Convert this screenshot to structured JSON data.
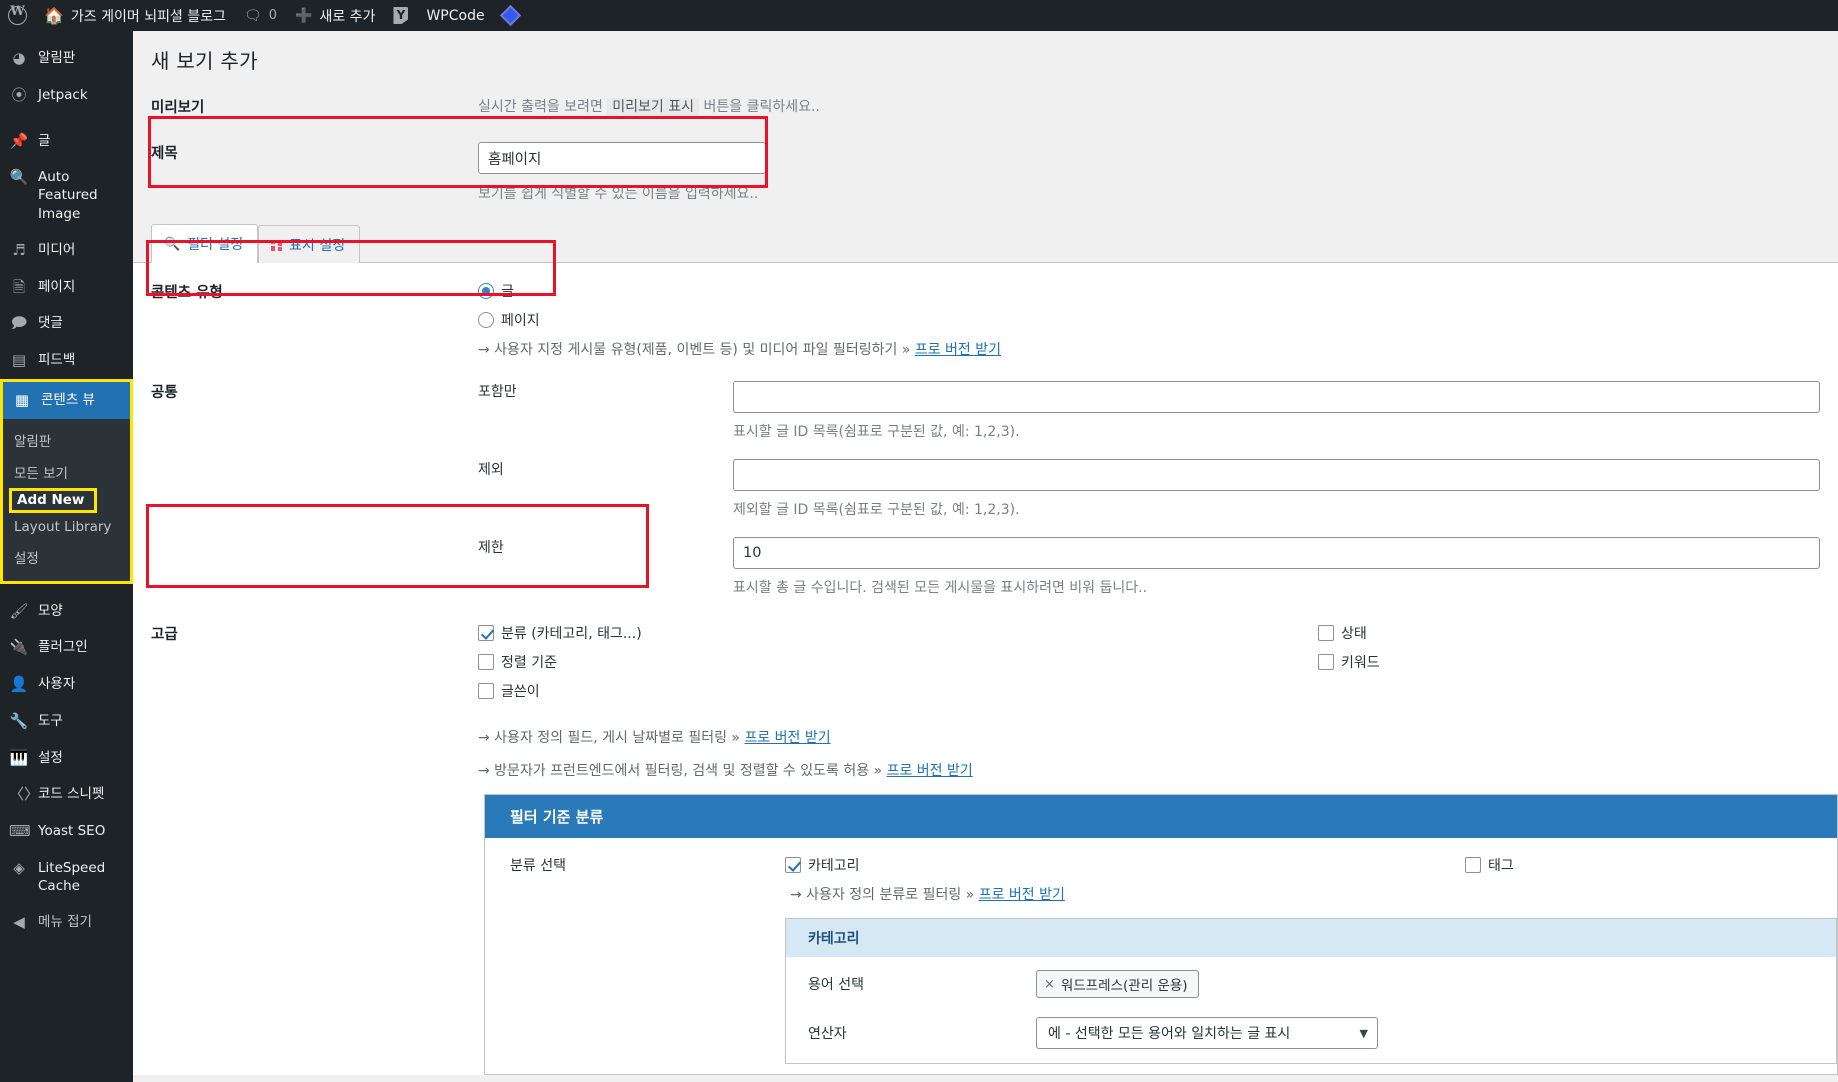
{
  "adminbar": {
    "wp_logo": "wordpress-logo",
    "site_name": "가즈 게이머 뇌피셜 블로그",
    "comments_count": "0",
    "new_label": "새로 추가",
    "wpcode_label": "WPCode"
  },
  "sidebar": {
    "items": [
      {
        "label": "알림판",
        "icon": "dashboard-icon"
      },
      {
        "label": "Jetpack",
        "icon": "jetpack-icon"
      },
      {
        "label": "글",
        "icon": "pin-icon"
      },
      {
        "label": "Auto Featured Image",
        "icon": "image-search-icon"
      },
      {
        "label": "미디어",
        "icon": "media-icon"
      },
      {
        "label": "페이지",
        "icon": "page-icon"
      },
      {
        "label": "댓글",
        "icon": "comment-icon"
      },
      {
        "label": "피드백",
        "icon": "feedback-icon"
      }
    ],
    "current": {
      "label": "콘텐츠 뷰",
      "icon": "content-views-icon"
    },
    "submenu": [
      {
        "label": "알림판",
        "active": false
      },
      {
        "label": "모든 보기",
        "active": false
      },
      {
        "label": "Add New",
        "active": true
      },
      {
        "label": "Layout Library",
        "active": false
      },
      {
        "label": "설정",
        "active": false
      }
    ],
    "items_after": [
      {
        "label": "모양",
        "icon": "appearance-icon"
      },
      {
        "label": "플러그인",
        "icon": "plugin-icon"
      },
      {
        "label": "사용자",
        "icon": "users-icon"
      },
      {
        "label": "도구",
        "icon": "tools-icon"
      },
      {
        "label": "설정",
        "icon": "settings-icon"
      },
      {
        "label": "코드 스니펫",
        "icon": "code-snippet-icon"
      },
      {
        "label": "Yoast SEO",
        "icon": "yoast-icon"
      },
      {
        "label": "LiteSpeed Cache",
        "icon": "litespeed-icon"
      }
    ],
    "collapse": {
      "label": "메뉴 접기",
      "icon": "collapse-icon"
    }
  },
  "page": {
    "title": "새 보기 추가"
  },
  "preview": {
    "label": "미리보기",
    "desc_before": "실시간 출력을 보려면",
    "button_text": "미리보기 표시",
    "desc_after": "버튼을 클릭하세요.."
  },
  "title_field": {
    "label": "제목",
    "value": "홈페이지",
    "hint": "보기를 쉽게 식별할 수 있는 이름을 입력하세요.."
  },
  "tabs": [
    {
      "label": "필터 설정",
      "icon": "search-icon",
      "active": true
    },
    {
      "label": "표시 설정",
      "icon": "grid-icon",
      "active": false
    }
  ],
  "content_type": {
    "label": "콘텐츠 유형",
    "options": [
      {
        "label": "글",
        "selected": true
      },
      {
        "label": "페이지",
        "selected": false
      }
    ],
    "hint_text": "→ 사용자 지정 게시물 유형(제품, 이벤트 등) 및 미디어 파일 필터링하기 »",
    "hint_link": "프로 버전 받기"
  },
  "common": {
    "label": "공통",
    "fields": [
      {
        "label": "포함만",
        "value": "",
        "hint": "표시할 글 ID 목록(쉼표로 구분된 값, 예: 1,2,3)."
      },
      {
        "label": "제외",
        "value": "",
        "hint": "제외할 글 ID 목록(쉼표로 구분된 값, 예: 1,2,3)."
      },
      {
        "label": "제한",
        "value": "10",
        "hint": "표시할 총 글 수입니다. 검색된 모든 게시물을 표시하려면 비워 둡니다.."
      }
    ]
  },
  "advanced": {
    "label": "고급",
    "left_checkboxes": [
      {
        "label": "분류 (카테고리, 태그...)",
        "checked": true
      },
      {
        "label": "정렬 기준",
        "checked": false
      },
      {
        "label": "글쓴이",
        "checked": false
      }
    ],
    "right_checkboxes": [
      {
        "label": "상태",
        "checked": false
      },
      {
        "label": "키워드",
        "checked": false
      }
    ],
    "hint1_text": "→ 사용자 정의 필드, 게시 날짜별로 필터링 »",
    "hint1_link": "프로 버전 받기",
    "hint2_text": "→ 방문자가 프런트엔드에서 필터링, 검색 및 정렬할 수 있도록 허용 »",
    "hint2_link": "프로 버전 받기"
  },
  "taxonomy_panel": {
    "heading": "필터 기준 분류",
    "select_label": "분류 선택",
    "checkboxes": [
      {
        "label": "카테고리",
        "checked": true
      },
      {
        "label": "태그",
        "checked": false
      }
    ],
    "hint_text": "→ 사용자 정의 분류로 필터링 »",
    "hint_link": "프로 버전 받기",
    "inner": {
      "heading": "카테고리",
      "term_label": "용어 선택",
      "term_value": "워드프레스(관리 운용)",
      "term_remove": "×",
      "operator_label": "연산자",
      "operator_value": "에 - 선택한 모든 용어와 일치하는 글 표시"
    }
  },
  "colors": {
    "annotation": "#e8132b",
    "highlight": "#ffe600",
    "accent_blue": "#2271b1",
    "panel_blue": "#2a79b9"
  }
}
